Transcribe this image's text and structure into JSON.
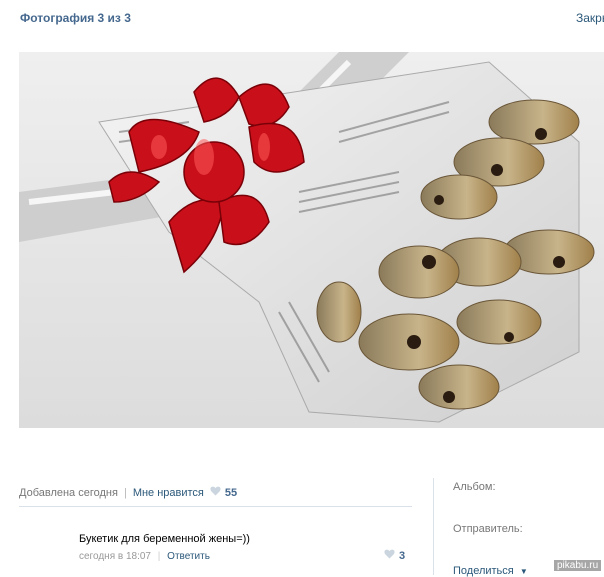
{
  "header": {
    "title": "Фотография 3 из 3",
    "close_label": "Закрыть"
  },
  "photo": {
    "description_icon": "photo-image"
  },
  "meta": {
    "added": "Добавлена сегодня",
    "like_label": "Мне нравится",
    "like_count": "55"
  },
  "comment": {
    "text": "Букетик для беременной жены=))",
    "time": "сегодня в 18:07",
    "reply_label": "Ответить",
    "like_count": "3"
  },
  "sidebar": {
    "album_label": "Альбом:",
    "sender_label": "Отправитель:",
    "share_label": "Поделиться"
  },
  "watermark": "pikabu.ru",
  "colors": {
    "link": "#2b587a",
    "title": "#45688e",
    "heart": "#cbd5df",
    "ribbon": "#c9101a"
  }
}
